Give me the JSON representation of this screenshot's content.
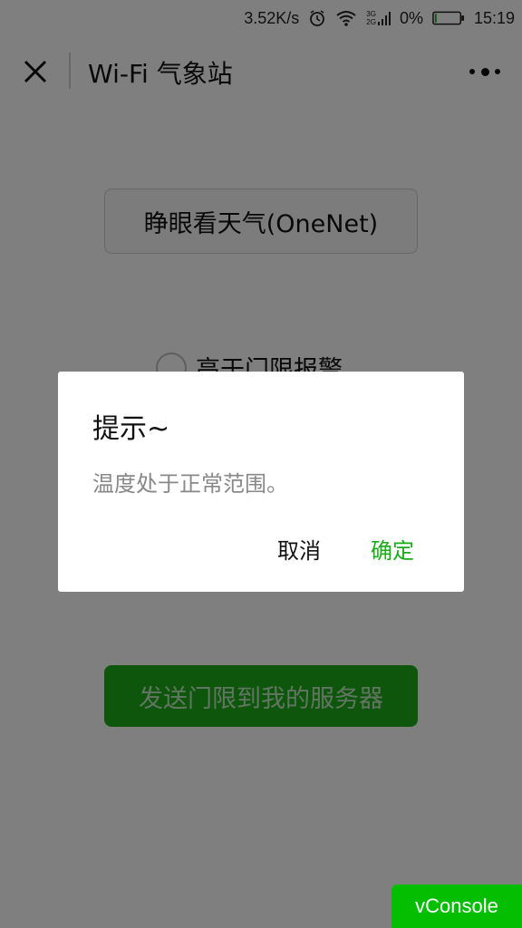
{
  "status_bar": {
    "net_speed": "3.52K/s",
    "network_label_top": "3G",
    "network_label_bottom": "2G",
    "battery_percent": "0%",
    "time": "15:19",
    "icons": [
      "alarm-icon",
      "wifi-icon",
      "signal-icon",
      "battery-icon"
    ]
  },
  "nav": {
    "title": "Wi-Fi 气象站",
    "close_icon": "close-icon",
    "more_icon": "more-icon"
  },
  "main": {
    "weather_button_label": "睁眼看天气(OneNet)",
    "radio_label": "高于门限报警",
    "send_button_label": "发送门限到我的服务器"
  },
  "dialog": {
    "title": "提示~",
    "content": "温度处于正常范围。",
    "cancel_label": "取消",
    "ok_label": "确定"
  },
  "vconsole": {
    "label": "vConsole"
  },
  "colors": {
    "accent_green": "#1aad19",
    "vconsole_green": "#04be02",
    "overlay": "rgba(0,0,0,0.5)"
  }
}
